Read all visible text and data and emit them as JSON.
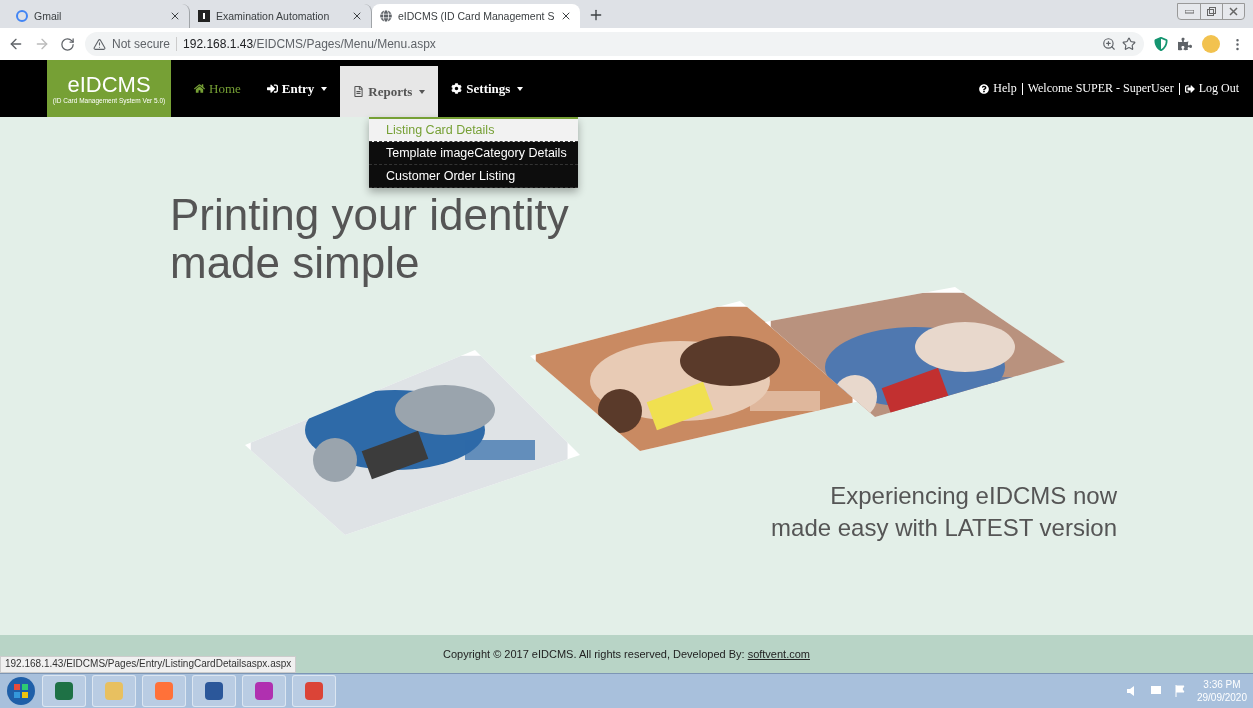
{
  "browser": {
    "tabs": [
      {
        "title": "Gmail",
        "selected": false
      },
      {
        "title": "Examination Automation",
        "selected": false
      },
      {
        "title": "eIDCMS (ID Card Management S",
        "selected": true
      }
    ],
    "security": "Not secure",
    "url_host": "192.168.1.43",
    "url_path": "/EIDCMS/Pages/Menu/Menu.aspx"
  },
  "navbar": {
    "brand": "eIDCMS",
    "brand_subtitle": "(ID Card Management System Ver 5.0)",
    "menu": [
      {
        "label": "Home",
        "selected": true,
        "expanded": false,
        "dropdown": false
      },
      {
        "label": "Entry",
        "selected": false,
        "expanded": false,
        "dropdown": true
      },
      {
        "label": "Reports",
        "selected": false,
        "expanded": true,
        "dropdown": true
      },
      {
        "label": "Settings",
        "selected": false,
        "expanded": false,
        "dropdown": true
      }
    ],
    "dropdown_items": [
      {
        "label": "Listing Card Details",
        "selected": true
      },
      {
        "label": "Template imageCategory Details",
        "selected": false
      },
      {
        "label": "Customer Order Listing",
        "selected": false
      }
    ],
    "right_links": [
      "Help",
      "Welcome SUPER - SuperUser",
      "Log Out"
    ]
  },
  "hero": {
    "headline": [
      "Printing your identity",
      "made simple"
    ],
    "tagline": [
      "Experiencing eIDCMS now",
      "made easy with LATEST version"
    ]
  },
  "footer": {
    "copyright": "Copyright © 2017 eIDCMS. All rights reserved, Developed By: ",
    "link": "softvent.com"
  },
  "status_url": "192.168.1.43/EIDCMS/Pages/Entry/ListingCardDetailsaspx.aspx",
  "taskbar": {
    "time": "3:36 PM",
    "date": "29/09/2020"
  }
}
